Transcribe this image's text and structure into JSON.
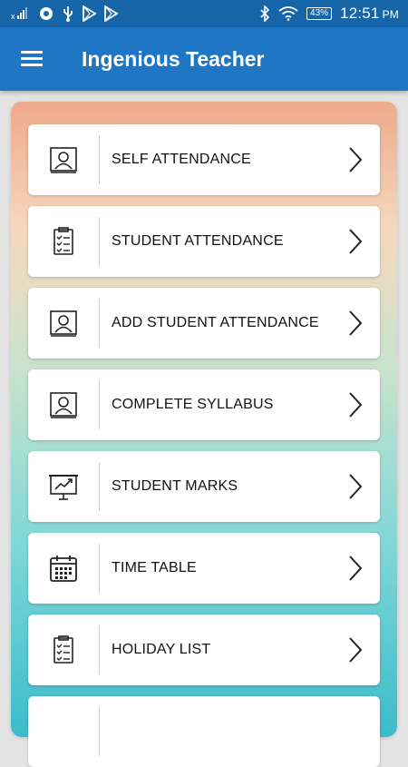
{
  "status_bar": {
    "battery": "43%",
    "time": "12:51",
    "ampm": "PM"
  },
  "app_bar": {
    "title": "Ingenious Teacher"
  },
  "menu": [
    {
      "label": "SELF ATTENDANCE",
      "icon": "profile-card-icon"
    },
    {
      "label": "STUDENT ATTENDANCE",
      "icon": "clipboard-checklist-icon"
    },
    {
      "label": "ADD STUDENT ATTENDANCE",
      "icon": "profile-card-icon"
    },
    {
      "label": "COMPLETE SYLLABUS",
      "icon": "profile-card-icon"
    },
    {
      "label": "STUDENT MARKS",
      "icon": "presentation-chart-icon"
    },
    {
      "label": "TIME TABLE",
      "icon": "calendar-icon"
    },
    {
      "label": "HOLIDAY LIST",
      "icon": "clipboard-checklist-icon"
    },
    {
      "label": "",
      "icon": ""
    }
  ],
  "colors": {
    "status_bar": "#1565a8",
    "app_bar": "#1e76c4",
    "gradient_top": "#eda98c",
    "gradient_bottom": "#3bbccb"
  }
}
